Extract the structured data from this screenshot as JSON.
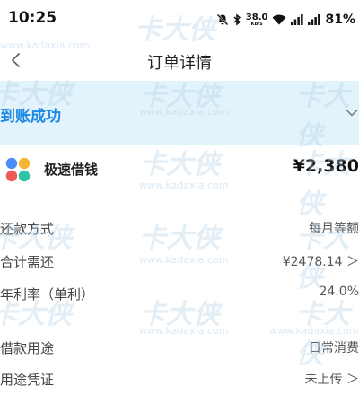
{
  "status_bar": {
    "time": "10:25",
    "net_speed": "38.0",
    "net_unit": "KB/S",
    "battery": "81%",
    "icons": [
      "mute-icon",
      "bluetooth-icon",
      "wifi-icon",
      "signal-icon",
      "battery-icon"
    ]
  },
  "nav": {
    "title": "订单详情",
    "back_icon": "chevron-left-icon"
  },
  "banner": {
    "status": "到账成功",
    "color": "#1e88e5",
    "background": "#e3f3fb"
  },
  "product": {
    "name": "极速借钱",
    "amount": "¥2,380"
  },
  "details": [
    {
      "label": "还款方式",
      "value": "每月等额"
    },
    {
      "label": "合计需还",
      "value": "¥2478.14 ＞"
    },
    {
      "label": "年利率（单利）",
      "value": "24.0%"
    },
    {
      "label": "借款用途",
      "value": "日常消费"
    },
    {
      "label": "用途凭证",
      "value": "未上传 ＞"
    }
  ],
  "watermark": {
    "text": "卡大侠",
    "url": "www.kadaxia.com"
  }
}
